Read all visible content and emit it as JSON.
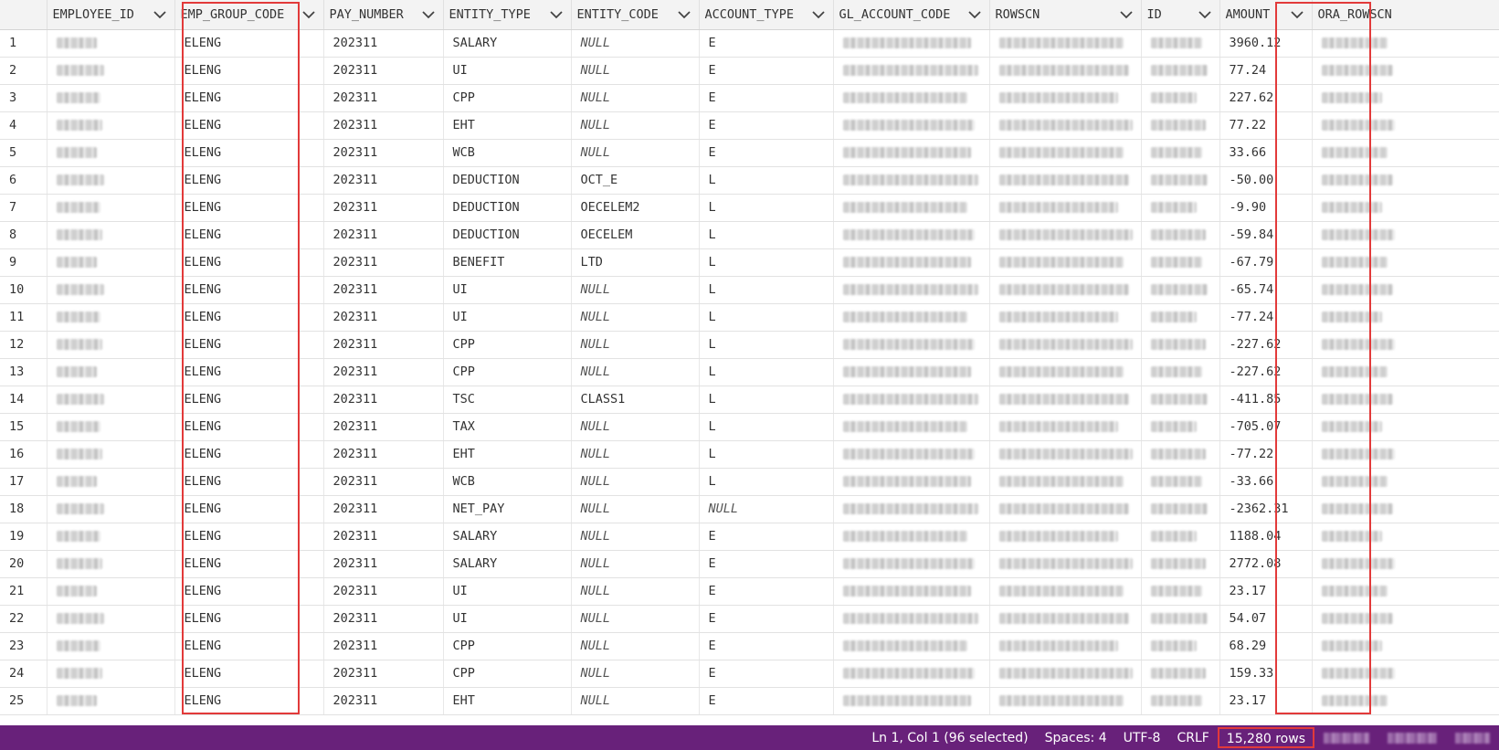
{
  "columns": [
    {
      "key": "rownum",
      "label": ""
    },
    {
      "key": "employee_id",
      "label": "EMPLOYEE_ID"
    },
    {
      "key": "emp_group_code",
      "label": "EMP_GROUP_CODE"
    },
    {
      "key": "pay_number",
      "label": "PAY_NUMBER"
    },
    {
      "key": "entity_type",
      "label": "ENTITY_TYPE"
    },
    {
      "key": "entity_code",
      "label": "ENTITY_CODE"
    },
    {
      "key": "account_type",
      "label": "ACCOUNT_TYPE"
    },
    {
      "key": "gl_account_code",
      "label": "GL_ACCOUNT_CODE"
    },
    {
      "key": "rowscn",
      "label": "ROWSCN"
    },
    {
      "key": "id",
      "label": "ID"
    },
    {
      "key": "amount",
      "label": "AMOUNT"
    },
    {
      "key": "ora_rowscn",
      "label": "ORA_ROWSCN"
    }
  ],
  "rows": [
    {
      "n": "1",
      "group": "ELENG",
      "pay": "202311",
      "etype": "SALARY",
      "ecode": "NULL",
      "atype": "E",
      "amount": "3960.12"
    },
    {
      "n": "2",
      "group": "ELENG",
      "pay": "202311",
      "etype": "UI",
      "ecode": "NULL",
      "atype": "E",
      "amount": "77.24"
    },
    {
      "n": "3",
      "group": "ELENG",
      "pay": "202311",
      "etype": "CPP",
      "ecode": "NULL",
      "atype": "E",
      "amount": "227.62"
    },
    {
      "n": "4",
      "group": "ELENG",
      "pay": "202311",
      "etype": "EHT",
      "ecode": "NULL",
      "atype": "E",
      "amount": "77.22"
    },
    {
      "n": "5",
      "group": "ELENG",
      "pay": "202311",
      "etype": "WCB",
      "ecode": "NULL",
      "atype": "E",
      "amount": "33.66"
    },
    {
      "n": "6",
      "group": "ELENG",
      "pay": "202311",
      "etype": "DEDUCTION",
      "ecode": "OCT_E",
      "atype": "L",
      "amount": "-50.00"
    },
    {
      "n": "7",
      "group": "ELENG",
      "pay": "202311",
      "etype": "DEDUCTION",
      "ecode": "OECELEM2",
      "atype": "L",
      "amount": "-9.90"
    },
    {
      "n": "8",
      "group": "ELENG",
      "pay": "202311",
      "etype": "DEDUCTION",
      "ecode": "OECELEM",
      "atype": "L",
      "amount": "-59.84"
    },
    {
      "n": "9",
      "group": "ELENG",
      "pay": "202311",
      "etype": "BENEFIT",
      "ecode": "LTD",
      "atype": "L",
      "amount": "-67.79"
    },
    {
      "n": "10",
      "group": "ELENG",
      "pay": "202311",
      "etype": "UI",
      "ecode": "NULL",
      "atype": "L",
      "amount": "-65.74"
    },
    {
      "n": "11",
      "group": "ELENG",
      "pay": "202311",
      "etype": "UI",
      "ecode": "NULL",
      "atype": "L",
      "amount": "-77.24"
    },
    {
      "n": "12",
      "group": "ELENG",
      "pay": "202311",
      "etype": "CPP",
      "ecode": "NULL",
      "atype": "L",
      "amount": "-227.62"
    },
    {
      "n": "13",
      "group": "ELENG",
      "pay": "202311",
      "etype": "CPP",
      "ecode": "NULL",
      "atype": "L",
      "amount": "-227.62"
    },
    {
      "n": "14",
      "group": "ELENG",
      "pay": "202311",
      "etype": "TSC",
      "ecode": "CLASS1",
      "atype": "L",
      "amount": "-411.85"
    },
    {
      "n": "15",
      "group": "ELENG",
      "pay": "202311",
      "etype": "TAX",
      "ecode": "NULL",
      "atype": "L",
      "amount": "-705.07"
    },
    {
      "n": "16",
      "group": "ELENG",
      "pay": "202311",
      "etype": "EHT",
      "ecode": "NULL",
      "atype": "L",
      "amount": "-77.22"
    },
    {
      "n": "17",
      "group": "ELENG",
      "pay": "202311",
      "etype": "WCB",
      "ecode": "NULL",
      "atype": "L",
      "amount": "-33.66"
    },
    {
      "n": "18",
      "group": "ELENG",
      "pay": "202311",
      "etype": "NET_PAY",
      "ecode": "NULL",
      "atype": "NULL",
      "amount": "-2362.31"
    },
    {
      "n": "19",
      "group": "ELENG",
      "pay": "202311",
      "etype": "SALARY",
      "ecode": "NULL",
      "atype": "E",
      "amount": "1188.04"
    },
    {
      "n": "20",
      "group": "ELENG",
      "pay": "202311",
      "etype": "SALARY",
      "ecode": "NULL",
      "atype": "E",
      "amount": "2772.08"
    },
    {
      "n": "21",
      "group": "ELENG",
      "pay": "202311",
      "etype": "UI",
      "ecode": "NULL",
      "atype": "E",
      "amount": "23.17"
    },
    {
      "n": "22",
      "group": "ELENG",
      "pay": "202311",
      "etype": "UI",
      "ecode": "NULL",
      "atype": "E",
      "amount": "54.07"
    },
    {
      "n": "23",
      "group": "ELENG",
      "pay": "202311",
      "etype": "CPP",
      "ecode": "NULL",
      "atype": "E",
      "amount": "68.29"
    },
    {
      "n": "24",
      "group": "ELENG",
      "pay": "202311",
      "etype": "CPP",
      "ecode": "NULL",
      "atype": "E",
      "amount": "159.33"
    },
    {
      "n": "25",
      "group": "ELENG",
      "pay": "202311",
      "etype": "EHT",
      "ecode": "NULL",
      "atype": "E",
      "amount": "23.17"
    }
  ],
  "status": {
    "cursor": "Ln 1, Col 1 (96 selected)",
    "spaces": "Spaces: 4",
    "encoding": "UTF-8",
    "eol": "CRLF",
    "rows": "15,280 rows"
  },
  "icons": {
    "column_menu": "chevron-down-icon"
  },
  "colors": {
    "statusbar_bg": "#68217a",
    "highlight": "#e23a3a"
  }
}
